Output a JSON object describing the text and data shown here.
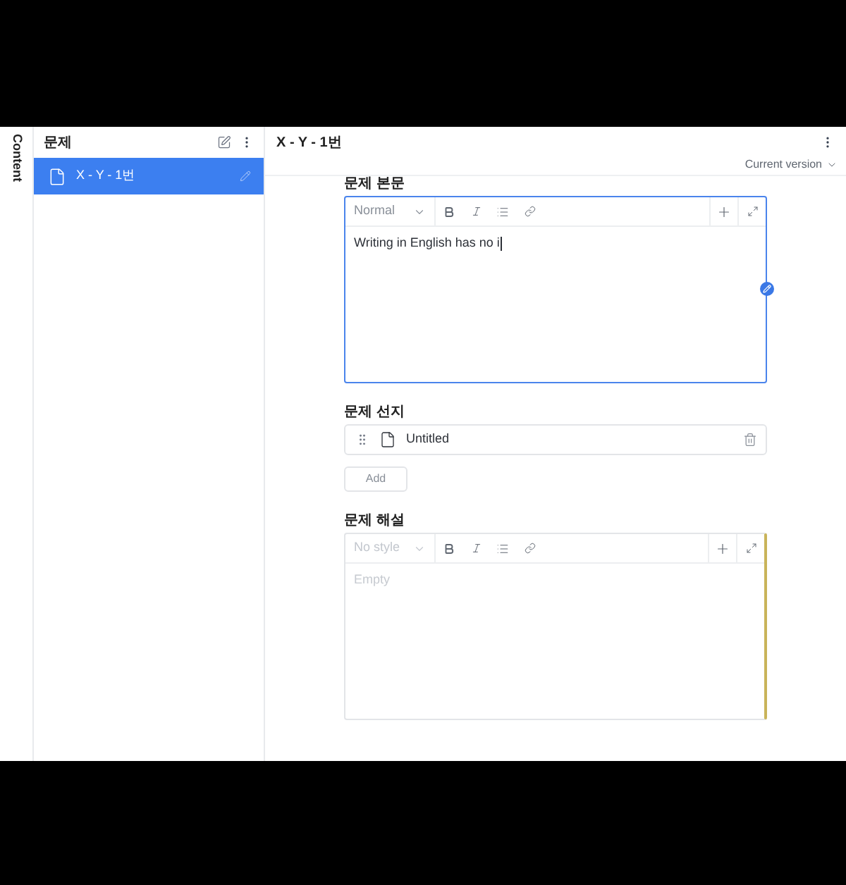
{
  "rail": {
    "label": "Content"
  },
  "list_pane": {
    "title": "문제",
    "items": [
      {
        "title": "X - Y - 1번",
        "selected": true
      }
    ]
  },
  "document": {
    "title": "X - Y - 1번",
    "version": "Current version",
    "fields": [
      {
        "kind": "editor",
        "label": "문제 본문",
        "style": "Normal",
        "value": "Writing in English has no i",
        "focused": true,
        "edit_badge": true,
        "change_bar": false
      },
      {
        "kind": "array",
        "label": "문제 선지",
        "items": [
          {
            "title": "Untitled"
          }
        ],
        "add_button": "Add"
      },
      {
        "kind": "editor",
        "label": "문제 해설",
        "style": "No style",
        "placeholder": "Empty",
        "focused": false,
        "edit_badge": false,
        "change_bar": true
      }
    ]
  }
}
